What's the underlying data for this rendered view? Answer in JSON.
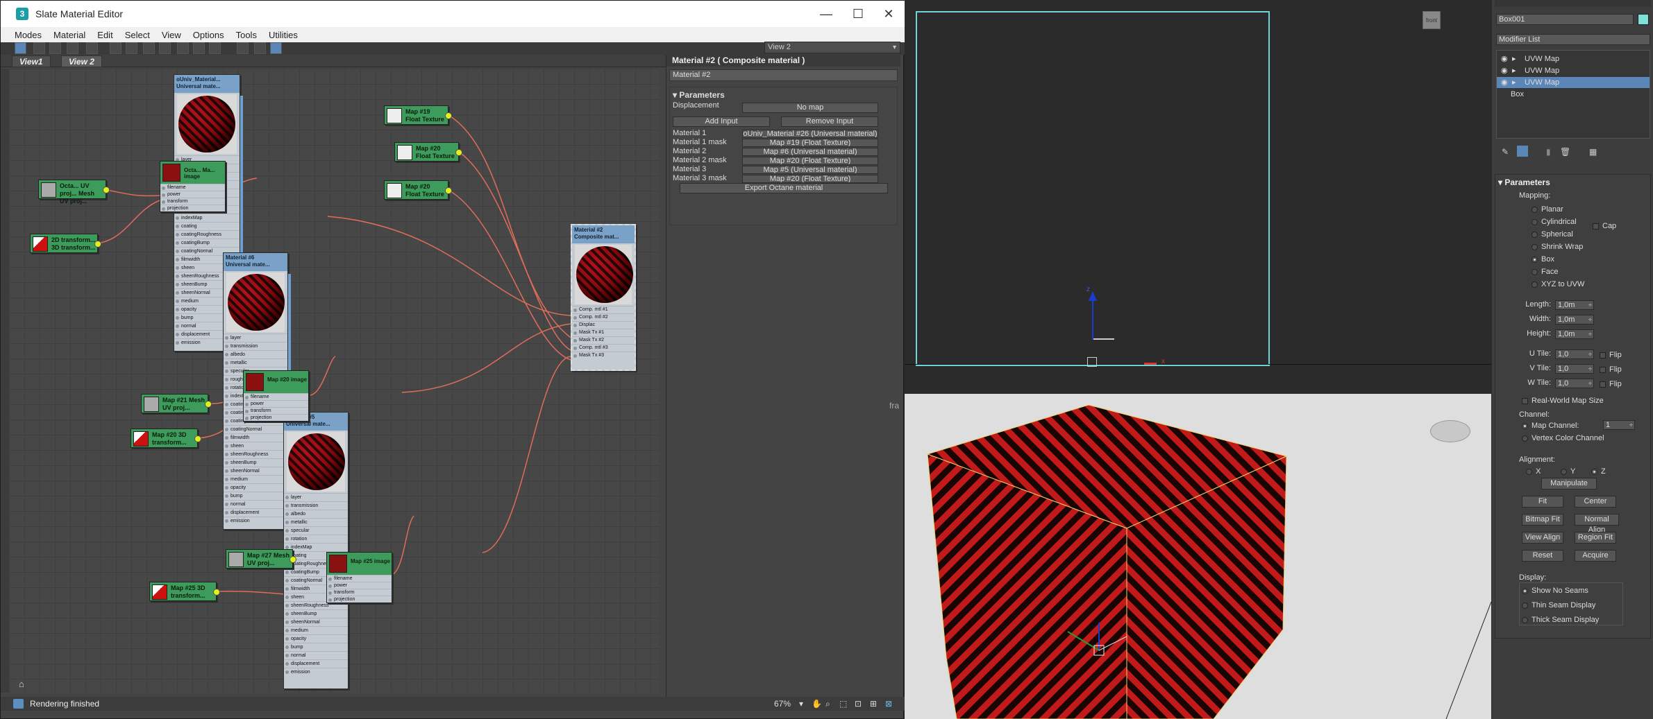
{
  "window": {
    "title": "Slate Material Editor",
    "minimize": "—",
    "maximize": "☐",
    "close": "✕"
  },
  "menu": [
    "Modes",
    "Material",
    "Edit",
    "Select",
    "View",
    "Options",
    "Tools",
    "Utilities"
  ],
  "view_select": "View 2",
  "view_tabs": [
    "View1",
    "View 2"
  ],
  "nodes": {
    "univ": {
      "title1": "oUniv_Material...",
      "title2": "Universal mate..."
    },
    "mat6": {
      "title1": "Material #6",
      "title2": "Universal mate..."
    },
    "mat5": {
      "title1": "Material #5",
      "title2": "Universal mate..."
    },
    "mat2": {
      "title1": "Material #2",
      "title2": "Composite mat...",
      "slots": [
        "Comp. mtl #1",
        "Comp. mtl #2",
        "Displac",
        "Mask Tx #1",
        "Mask Tx #2",
        "Comp. mtl #3",
        "Mask Tx #3"
      ]
    },
    "map19": {
      "line1": "Map #19",
      "line2": "Float Texture"
    },
    "map20a": {
      "line1": "Map #20",
      "line2": "Float Texture"
    },
    "map20b": {
      "line1": "Map #20",
      "line2": "Float Texture"
    },
    "img_a": {
      "label": "Octa... Ma... image"
    },
    "img_b": {
      "label": "Map #20 image"
    },
    "img_c": {
      "label": "Map #25 image"
    },
    "uvp_a": {
      "label": "Octa... UV proj... Mesh UV proj..."
    },
    "uvp_b": {
      "label": "Map #21 Mesh UV proj..."
    },
    "uvp_c": {
      "label": "Map #27 Mesh UV proj..."
    },
    "xf_a": {
      "label": "2D transform... 3D transform..."
    },
    "xf_b": {
      "label": "Map #20 3D transform..."
    },
    "xf_c": {
      "label": "Map #25 3D transform..."
    }
  },
  "img_slots": [
    "filename",
    "power",
    "transform",
    "projection"
  ],
  "univ_slots": [
    "layer",
    "transmission",
    "albedo",
    "metallic",
    "specular",
    "roughness",
    "rotation",
    "indexMap",
    "coating",
    "coatingRoughness",
    "coatingBump",
    "coatingNormal",
    "filmwidth",
    "sheen",
    "sheenRoughness",
    "sheenBump",
    "sheenNormal",
    "medium",
    "opacity",
    "bump",
    "normal",
    "displacement",
    "emission"
  ],
  "univ5_slots": [
    "layer",
    "transmission",
    "albedo",
    "metallic",
    "specular",
    "rotation",
    "indexMap",
    "coating",
    "coatingRoughness",
    "coatingBump",
    "coatingNormal",
    "filmwidth",
    "sheen",
    "sheenRoughness",
    "sheenBump",
    "sheenNormal",
    "medium",
    "opacity",
    "bump",
    "normal",
    "displacement",
    "emission"
  ],
  "panel": {
    "title": "Material #2  ( Composite material )",
    "name": "Material #2",
    "rollout": "Parameters",
    "displacement_label": "Displacement",
    "displacement_btn": "No map",
    "add_input": "Add Input",
    "remove_input": "Remove Input",
    "rows": [
      {
        "label": "Material 1",
        "btn": "oUniv_Material #26 (Universal material)"
      },
      {
        "label": "Material 1 mask",
        "btn": "Map #19 (Float Texture)"
      },
      {
        "label": "Material 2",
        "btn": "Map #6 (Universal material)"
      },
      {
        "label": "Material 2 mask",
        "btn": "Map #20 (Float Texture)"
      },
      {
        "label": "Material 3",
        "btn": "Map #5 (Universal material)"
      },
      {
        "label": "Material 3 mask",
        "btn": "Map #20 (Float Texture)"
      }
    ],
    "export": "Export Octane material"
  },
  "status": "Rendering finished",
  "zoom": "67%",
  "cmd": {
    "object_name": "Box001",
    "modifier_list": "Modifier List",
    "stack": [
      "UVW Map",
      "UVW Map",
      "UVW Map",
      "Box"
    ],
    "rollout": "Parameters",
    "mapping_label": "Mapping:",
    "mapping": [
      "Planar",
      "Cylindrical",
      "Spherical",
      "Shrink Wrap",
      "Box",
      "Face",
      "XYZ to UVW"
    ],
    "cap": "Cap",
    "length_label": "Length:",
    "length": "1,0m",
    "width_label": "Width:",
    "width": "1,0m",
    "height_label": "Height:",
    "height": "1,0m",
    "utile_label": "U Tile:",
    "utile": "1,0",
    "vtile_label": "V Tile:",
    "vtile": "1,0",
    "wtile_label": "W Tile:",
    "wtile": "1,0",
    "flip": "Flip",
    "realworld": "Real-World Map Size",
    "channel_label": "Channel:",
    "map_channel": "Map Channel:",
    "map_channel_val": "1",
    "vertex_color": "Vertex Color Channel",
    "alignment_label": "Alignment:",
    "axes": [
      "X",
      "Y",
      "Z"
    ],
    "manipulate": "Manipulate",
    "fit": "Fit",
    "center": "Center",
    "bitmap_fit": "Bitmap Fit",
    "normal_align": "Normal Align",
    "view_align": "View Align",
    "region_fit": "Region Fit",
    "reset": "Reset",
    "acquire": "Acquire",
    "display_label": "Display:",
    "display": [
      "Show No Seams",
      "Thin Seam Display",
      "Thick Seam Display"
    ]
  },
  "viewport": {
    "front_label": "front",
    "axis_x": "x",
    "axis_z": "z",
    "left_cut": "fra"
  }
}
